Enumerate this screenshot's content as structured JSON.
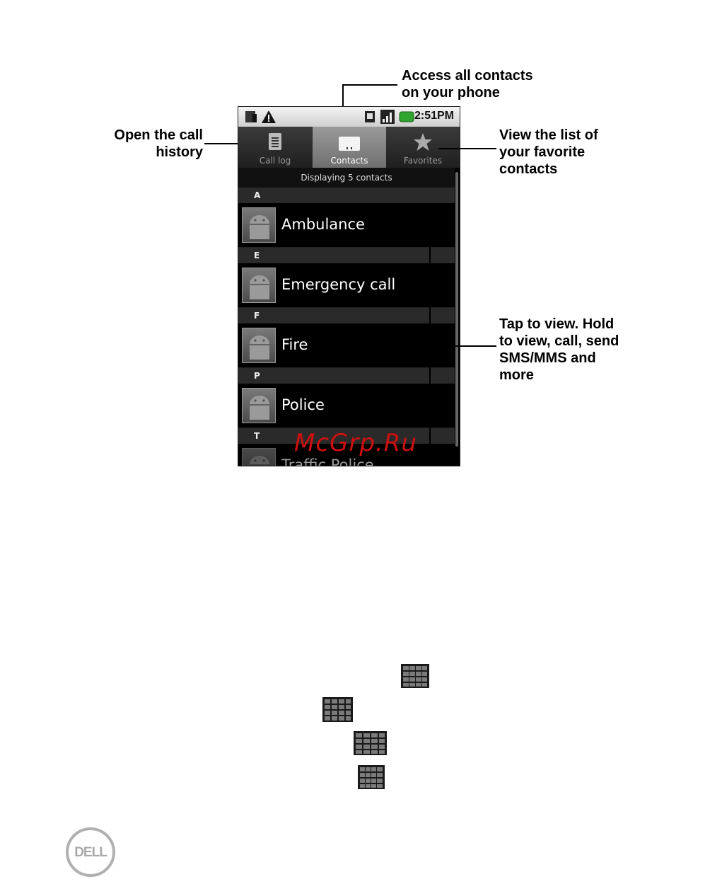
{
  "callouts": {
    "access_all": [
      "Access all contacts",
      "on your phone"
    ],
    "call_history": [
      "Open the call",
      "history"
    ],
    "favorites": [
      "View the list of",
      "your favorite",
      "contacts"
    ],
    "tap_to_view": [
      "Tap to view. Hold",
      "to view, call, send",
      "SMS/MMS and",
      "more"
    ]
  },
  "phone": {
    "time": "2:51PM",
    "tabs": [
      {
        "label": "Call log",
        "icon": "call-log-icon",
        "selected": false
      },
      {
        "label": "Contacts",
        "icon": "contacts-icon",
        "selected": true
      },
      {
        "label": "Favorites",
        "icon": "star-icon",
        "selected": false
      }
    ],
    "displaying": "Displaying 5 contacts",
    "sections": [
      {
        "letter": "A",
        "name": "Ambulance"
      },
      {
        "letter": "E",
        "name": "Emergency call"
      },
      {
        "letter": "F",
        "name": "Fire"
      },
      {
        "letter": "P",
        "name": "Police"
      },
      {
        "letter": "T",
        "name": "Traffic Police"
      }
    ]
  },
  "watermark": "McGrp.Ru",
  "logo_text": "DELL",
  "colors": {
    "watermark": "#cc1010",
    "selected_tab": "#8a8a8a"
  }
}
